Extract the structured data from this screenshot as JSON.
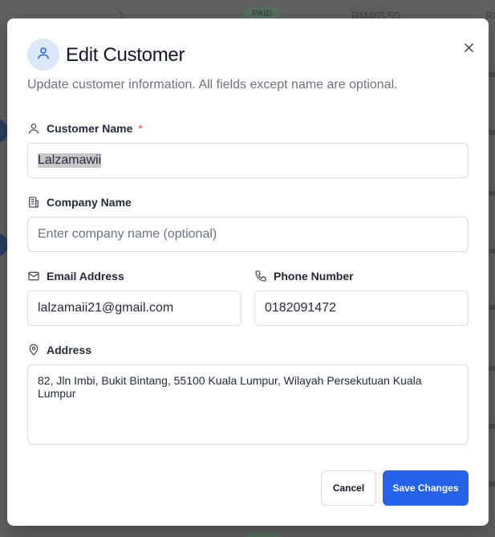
{
  "background": {
    "row_number": "1",
    "status_badge": "PAID",
    "amount": "RM465.50",
    "edge_text": "RM"
  },
  "modal": {
    "title": "Edit Customer",
    "subtitle": "Update customer information. All fields except name are optional.",
    "icons": {
      "header": "user-icon",
      "close": "close-icon"
    }
  },
  "form": {
    "customer_name": {
      "label": "Customer Name",
      "required_mark": "*",
      "value": "Lalzamawii",
      "icon": "user-icon"
    },
    "company_name": {
      "label": "Company Name",
      "value": "",
      "placeholder": "Enter company name (optional)",
      "icon": "building-icon"
    },
    "email": {
      "label": "Email Address",
      "value": "lalzamaii21@gmail.com",
      "icon": "mail-icon"
    },
    "phone": {
      "label": "Phone Number",
      "value": "0182091472",
      "icon": "phone-icon"
    },
    "address": {
      "label": "Address",
      "value": "82, Jln Imbi, Bukit Bintang, 55100 Kuala Lumpur, Wilayah Persekutuan Kuala Lumpur",
      "icon": "map-pin-icon"
    }
  },
  "actions": {
    "cancel_label": "Cancel",
    "save_label": "Save Changes"
  },
  "colors": {
    "primary": "#2563eb",
    "required": "#ef4444",
    "header_icon_bg": "#dbe7fb"
  }
}
